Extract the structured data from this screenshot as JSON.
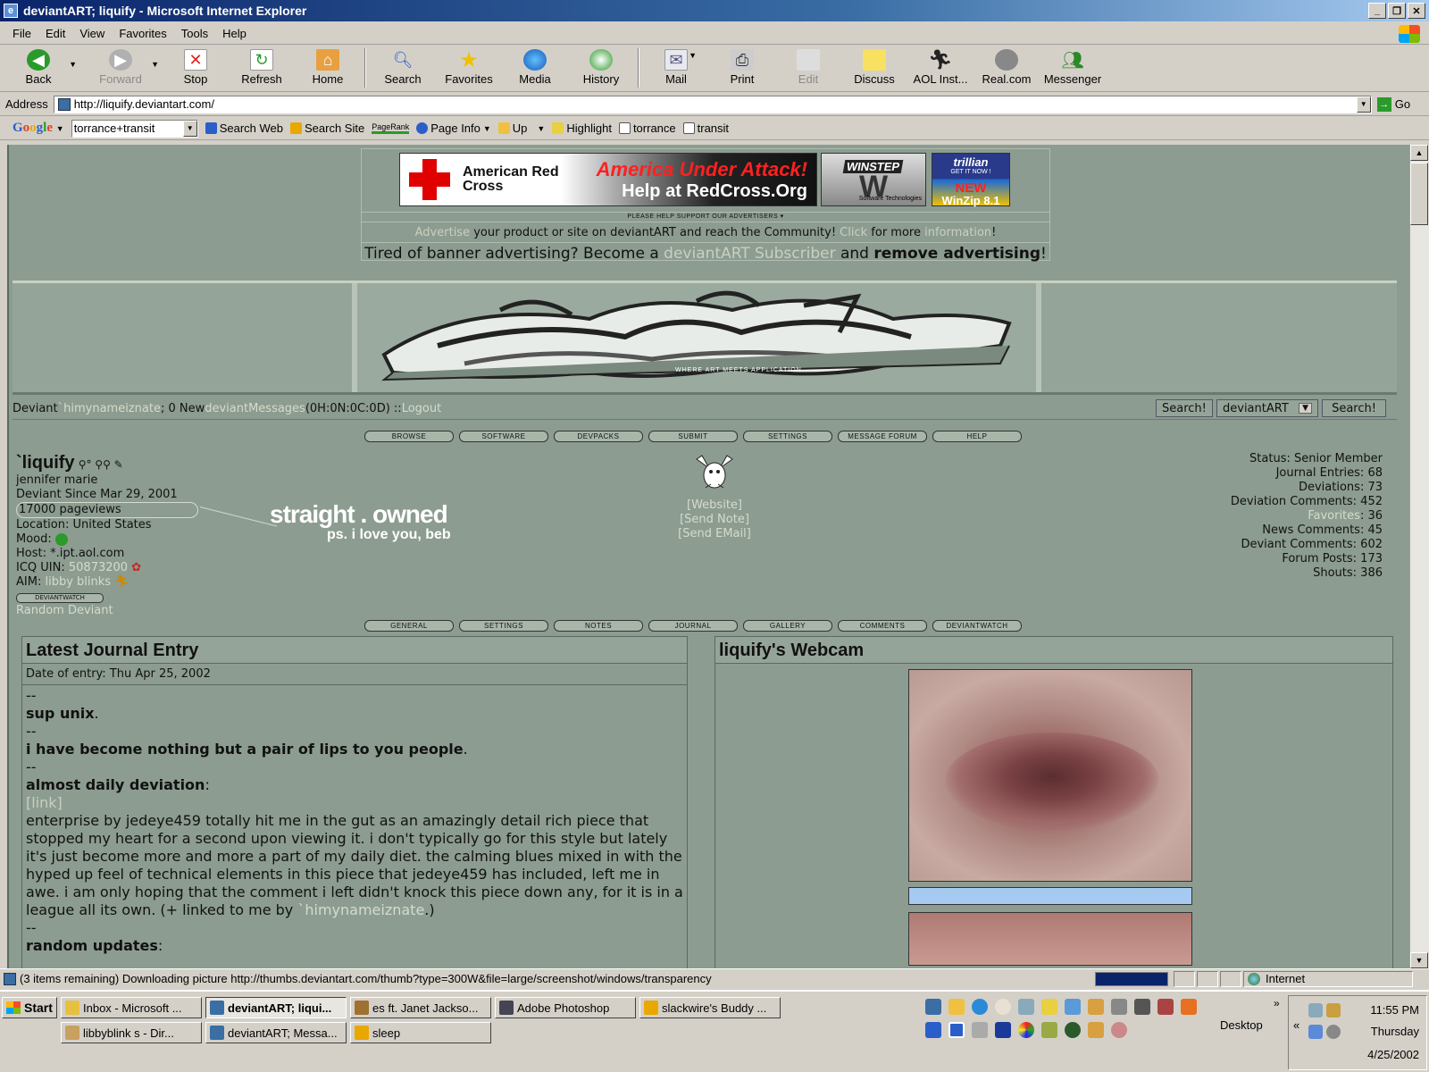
{
  "window": {
    "title": "deviantART; liquify - Microsoft Internet Explorer"
  },
  "menu": [
    "File",
    "Edit",
    "View",
    "Favorites",
    "Tools",
    "Help"
  ],
  "toolbar": {
    "back": "Back",
    "forward": "Forward",
    "stop": "Stop",
    "refresh": "Refresh",
    "home": "Home",
    "search": "Search",
    "favorites": "Favorites",
    "media": "Media",
    "history": "History",
    "mail": "Mail",
    "print": "Print",
    "edit": "Edit",
    "discuss": "Discuss",
    "aol": "AOL Inst...",
    "real": "Real.com",
    "messenger": "Messenger"
  },
  "address": {
    "label": "Address",
    "url": "http://liquify.deviantart.com/",
    "go": "Go"
  },
  "google": {
    "logo_parts": [
      "G",
      "o",
      "o",
      "g",
      "l",
      "e"
    ],
    "query": "torrance+transit",
    "search_web": "Search Web",
    "search_site": "Search Site",
    "pagerank": "PageRank",
    "page_info": "Page Info",
    "up": "Up",
    "highlight": "Highlight",
    "word1": "torrance",
    "word2": "transit"
  },
  "ads": {
    "redcross_name": "American Red Cross",
    "redcross_line1": "America Under Attack!",
    "redcross_line2": "Help at RedCross.Org",
    "winstep": "WINSTEP",
    "winstep_sub": "Software Technologies",
    "trillian": "trillian",
    "trillian_get": "GET IT NOW !",
    "winzip_new": "NEW",
    "winzip": "WinZip 8.1",
    "support": "PLEASE HELP SUPPORT OUR ADVERTISERS",
    "line1_advertise": "Advertise",
    "line1_mid": " your product or site on deviantART and reach the Community! ",
    "line1_click": "Click",
    "line1_formore": " for more ",
    "line1_info": "information",
    "line2_a": "Tired of banner advertising? Become a ",
    "line2_link": "deviantART Subscriber",
    "line2_b": " and ",
    "line2_bold": "remove advertising",
    "line2_c": "!"
  },
  "header": {
    "logo_tag": "WHERE  ART  MEETS  APPLICATION"
  },
  "deviantbar": {
    "prefix": "Deviant ",
    "user": "`himynameiznate",
    "mid": "; 0 New ",
    "messages": "deviantMessages",
    "counts": " (0H:0N:0C:0D) :: ",
    "logout": "Logout",
    "search_btn": "Search!",
    "search_scope": "deviantART",
    "search_btn2": "Search!"
  },
  "nav": [
    "BROWSE",
    "SOFTWARE",
    "DEVPACKS",
    "SUBMIT",
    "SETTINGS",
    "MESSAGE FORUM",
    "HELP"
  ],
  "profile": {
    "username": "`liquify",
    "realname": "jennifer marie",
    "since": "Deviant Since Mar 29, 2001",
    "pageviews": "17000 pageviews",
    "location": "Location: United States",
    "mood": "Mood:",
    "host": "Host: *.ipt.aol.com",
    "icq_label": "ICQ UIN: ",
    "icq": "50873200",
    "aim_label": "AIM: ",
    "aim": "libby blinks",
    "devwatch": "DEVIANTWATCH",
    "random": "Random Deviant",
    "tagline": "straight . owned",
    "tagline2": "ps. i love you, beb"
  },
  "links": {
    "website": "[Website]",
    "note": "[Send Note]",
    "email": "[Send EMail]"
  },
  "stats": {
    "status": "Status: Senior Member",
    "journal": "Journal Entries: 68",
    "deviations": "Deviations: 73",
    "dev_comments": "Deviation Comments: 452",
    "favorites_label": "Favorites",
    "favorites": ": 36",
    "news": "News Comments: 45",
    "deviant_comments": "Deviant Comments: 602",
    "forum": "Forum Posts: 173",
    "shouts": "Shouts: 386"
  },
  "subnav": [
    "GENERAL",
    "SETTINGS",
    "NOTES",
    "JOURNAL",
    "GALLERY",
    "COMMENTS",
    "DEVIANTWATCH"
  ],
  "journal": {
    "title": "Latest Journal Entry",
    "date": "Date of entry: Thu Apr 25, 2002",
    "dash": "--",
    "h1": "sup unix",
    "h2": "i have become nothing but a pair of lips to you people",
    "h3": "almost daily deviation",
    "link": "[link]",
    "para": "enterprise by jedeye459 totally hit me in the gut as an amazingly detail rich piece that stopped my heart for a second upon viewing it. i don't typically go for this style but lately it's just become more and more a part of my daily diet. the calming blues mixed in with the hyped up feel of technical elements in this piece that jedeye459 has included, left me in awe. i am only hoping that the comment i left didn't knock this piece down any, for it is in a league all its own. (+ linked to me by ",
    "para_link": "`himynameiznate",
    "para_end": ".)",
    "h4": "random updates"
  },
  "webcam": {
    "title": "liquify's Webcam"
  },
  "statusbar": {
    "text": "(3 items remaining) Downloading picture http://thumbs.deviantart.com/thumb?type=300W&file=large/screenshot/windows/transparency",
    "zone": "Internet"
  },
  "taskbar": {
    "start": "Start",
    "tasks": [
      "Inbox - Microsoft ...",
      "deviantART; liqui...",
      "es ft. Janet Jackso...",
      "Adobe Photoshop",
      "slackwire's Buddy ...",
      "libbyblink    s - Dir...",
      "deviantART; Messa...",
      "sleep"
    ],
    "desktop": "Desktop",
    "time": "11:55 PM",
    "day": "Thursday",
    "date": "4/25/2002"
  }
}
